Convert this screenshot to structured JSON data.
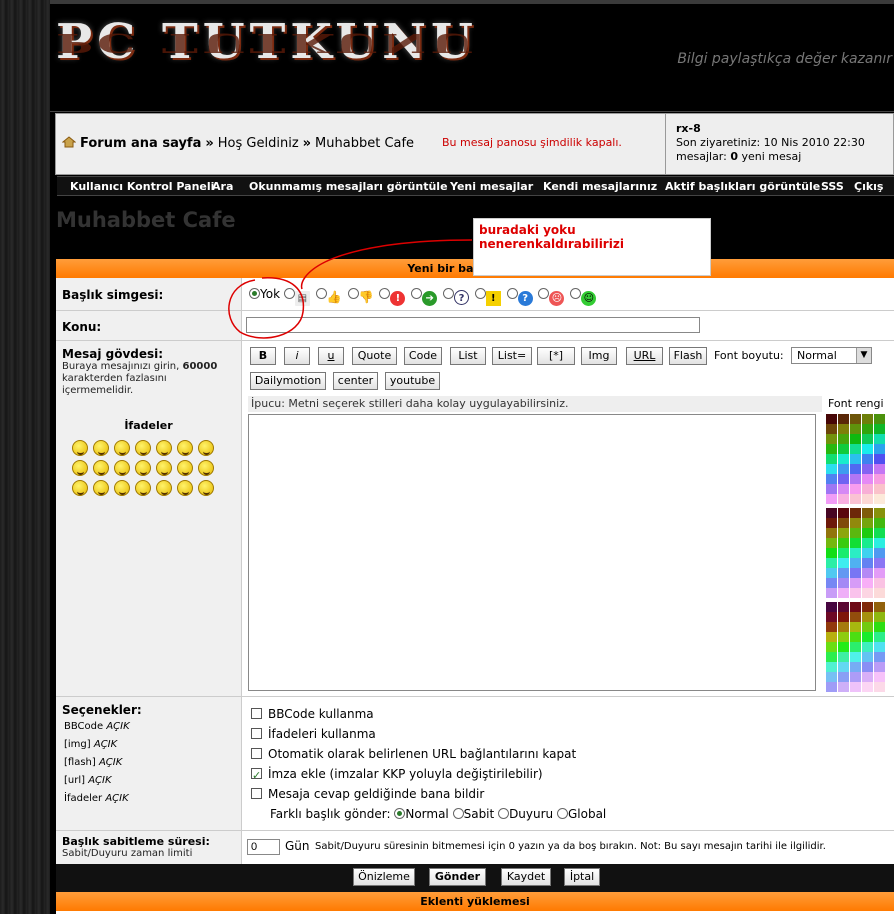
{
  "header": {
    "logo": "PC TUTKUNU",
    "slogan": "Bilgi paylaştıkça değer kazanır"
  },
  "breadcrumb": {
    "home": "Forum ana sayfa",
    "sep": "»",
    "item1": "Hoş Geldiniz",
    "item2": "Muhabbet Cafe"
  },
  "notice": "Bu mesaj panosu şimdilik kapalı.",
  "user": {
    "name": "rx-8",
    "last_visit": "Son ziyaretiniz: 10 Nis 2010 22:30",
    "messages_prefix": "mesajlar:",
    "messages_count": "0",
    "messages_suffix": "yeni mesaj"
  },
  "menu": [
    "Kullanıcı Kontrol Paneli",
    "Ara",
    "Okunmamış mesajları görüntüle",
    "Yeni mesajlar",
    "Kendi mesajlarınız",
    "Aktif başlıkları görüntüle",
    "SSS",
    "Çıkış"
  ],
  "page_title": "Muhabbet Cafe",
  "annotation": "buradaki yoku nenerenkaldırabilirizi",
  "form_title": "Yeni bir başlık gönder",
  "topic_icon": {
    "label": "Başlık simgesi:",
    "none_label": "Yok"
  },
  "subject": {
    "label": "Konu:",
    "value": ""
  },
  "body": {
    "label": "Mesaj gövdesi:",
    "desc1": "Buraya mesajınızı girin,",
    "limit": "60000",
    "desc2": "karakterden fazlasını içermemelidir.",
    "smilies_title": "İfadeler",
    "hint": "İpucu: Metni seçerek stilleri daha kolay uygulayabilirsiniz.",
    "font_color_label": "Font rengi",
    "font_size_label": "Font boyutu:",
    "font_size_value": "Normal",
    "content": ""
  },
  "buttons": {
    "b": "B",
    "i": "i",
    "u": "u",
    "quote": "Quote",
    "code": "Code",
    "list": "List",
    "listeq": "List=",
    "star": "[*]",
    "img": "Img",
    "url": "URL",
    "flash": "Flash",
    "dailymotion": "Dailymotion",
    "center": "center",
    "youtube": "youtube"
  },
  "options": {
    "label": "Seçenekler:",
    "status": [
      {
        "k": "BBCode",
        "v": "AÇIK"
      },
      {
        "k": "[img]",
        "v": "AÇIK"
      },
      {
        "k": "[flash]",
        "v": "AÇIK"
      },
      {
        "k": "[url]",
        "v": "AÇIK"
      },
      {
        "k": "İfadeler",
        "v": "AÇIK"
      }
    ],
    "checks": [
      "BBCode kullanma",
      "İfadeleri kullanma",
      "Otomatik olarak belirlenen URL bağlantılarını kapat",
      "İmza ekle (imzalar KKP yoluyla değiştirilebilir)",
      "Mesaja cevap geldiğinde bana bildir"
    ],
    "post_as_label": "Farklı başlık gönder:",
    "post_as": [
      "Normal",
      "Sabit",
      "Duyuru",
      "Global"
    ]
  },
  "sticky": {
    "label": "Başlık sabitleme süresi:",
    "sub": "Sabit/Duyuru zaman limiti",
    "value": "0",
    "unit": "Gün",
    "note": "Sabit/Duyuru süresinin bitmemesi için 0 yazın ya da boş bırakın. Not: Bu sayı mesajın tarihi ile ilgilidir."
  },
  "actions": {
    "preview": "Önizleme",
    "submit": "Gönder",
    "save": "Kaydet",
    "cancel": "İptal"
  },
  "attach_title": "Eklenti yüklemesi"
}
